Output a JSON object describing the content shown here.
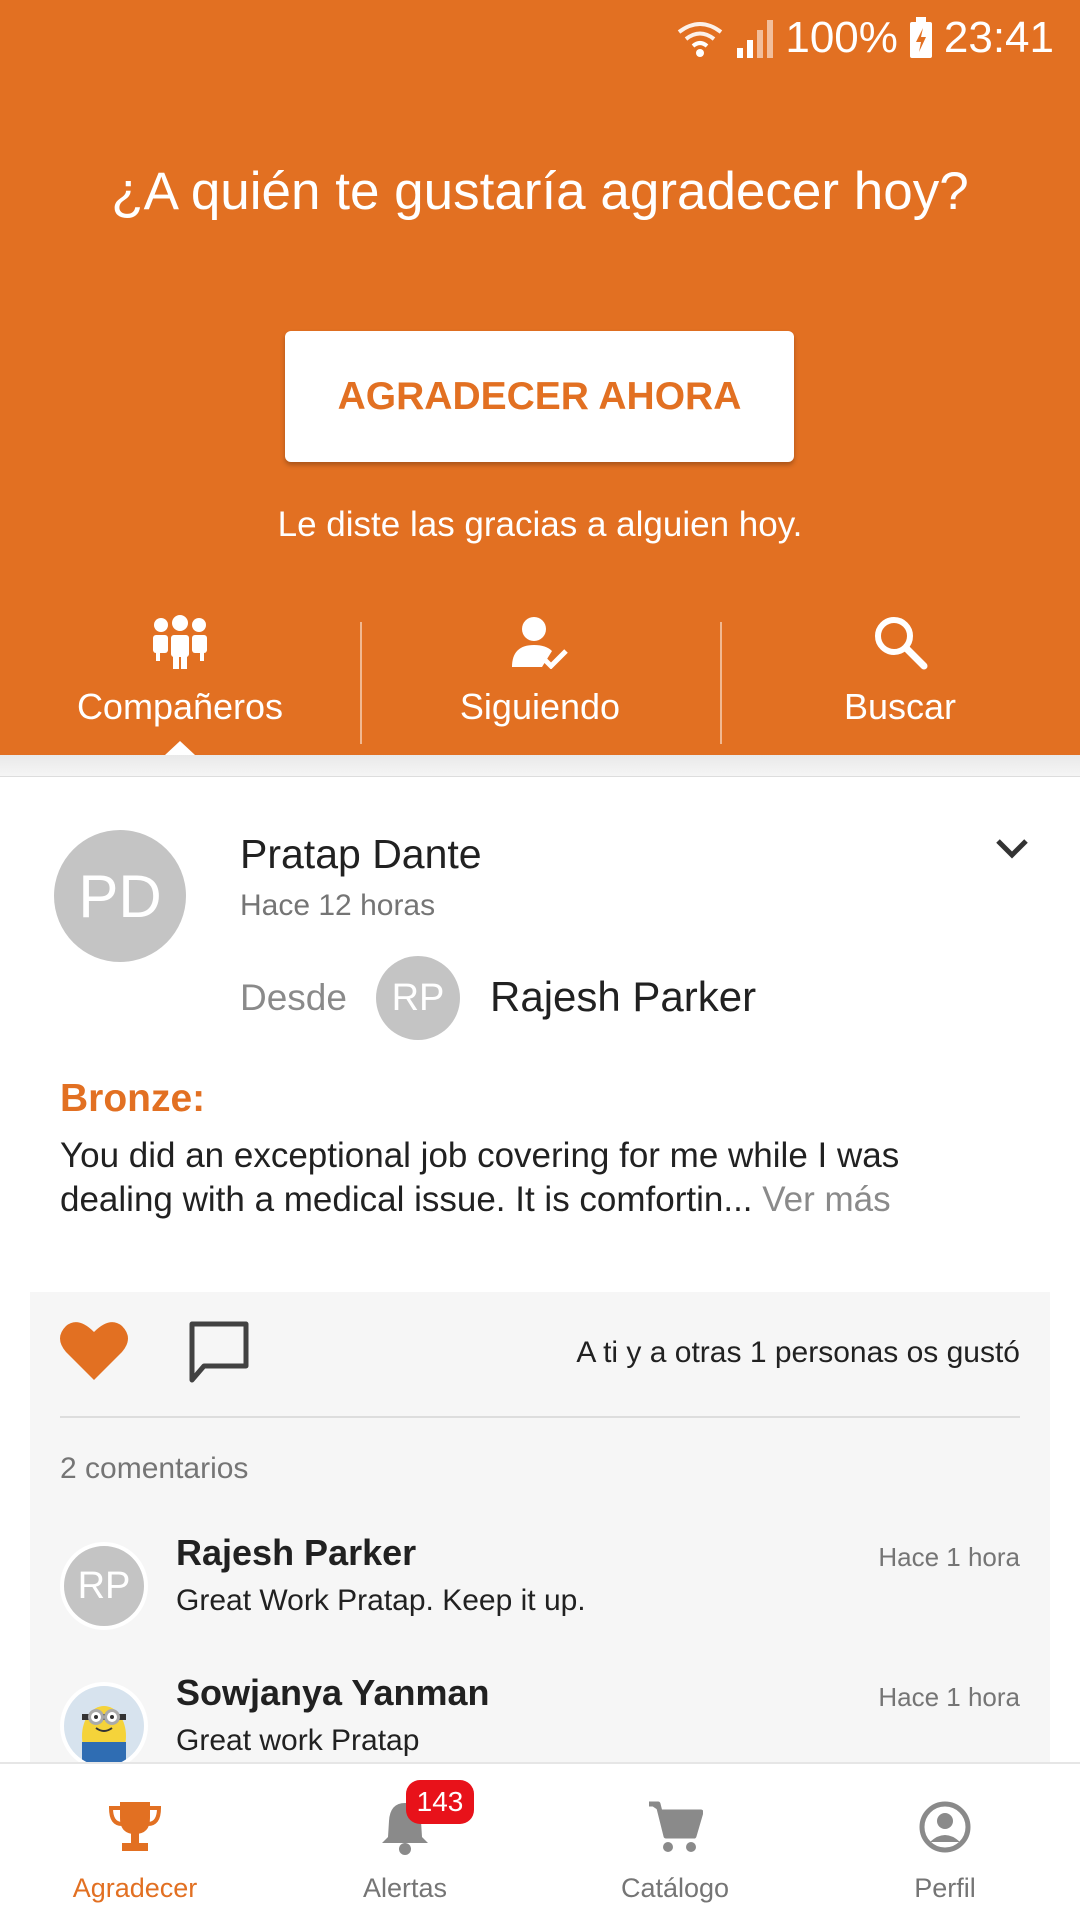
{
  "colors": {
    "accent": "#E27022",
    "badge": "#e8121a"
  },
  "status_bar": {
    "battery": "100%",
    "time": "23:41"
  },
  "header": {
    "headline": "¿A quién te gustaría agradecer hoy?",
    "cta_label": "AGRADECER AHORA",
    "subline": "Le diste las gracias a alguien hoy."
  },
  "tabs": [
    {
      "label": "Compañeros",
      "icon": "group-icon",
      "active": true
    },
    {
      "label": "Siguiendo",
      "icon": "person-check-icon",
      "active": false
    },
    {
      "label": "Buscar",
      "icon": "search-icon",
      "active": false
    }
  ],
  "post": {
    "recipient_initials": "PD",
    "recipient_name": "Pratap Dante",
    "time": "Hace 12 horas",
    "from_label": "Desde",
    "sender_initials": "RP",
    "sender_name": "Rajesh Parker",
    "award": "Bronze:",
    "message": "You did an exceptional job covering for me while I was dealing with a medical issue. It is comfortin...",
    "more_label": "Ver más",
    "likes_text": "A ti y a otras 1 personas os gustó",
    "comment_count": "2 comentarios",
    "comments": [
      {
        "author": "Rajesh Parker",
        "initials": "RP",
        "time": "Hace 1 hora",
        "text": "Great Work Pratap. Keep it up."
      },
      {
        "author": "Sowjanya Yanman",
        "initials": "",
        "time": "Hace 1 hora",
        "text": "Great work Pratap"
      }
    ]
  },
  "bottom_nav": [
    {
      "label": "Agradecer",
      "icon": "trophy-icon",
      "active": true
    },
    {
      "label": "Alertas",
      "icon": "bell-icon",
      "badge": "143"
    },
    {
      "label": "Catálogo",
      "icon": "cart-icon"
    },
    {
      "label": "Perfil",
      "icon": "profile-icon"
    }
  ]
}
